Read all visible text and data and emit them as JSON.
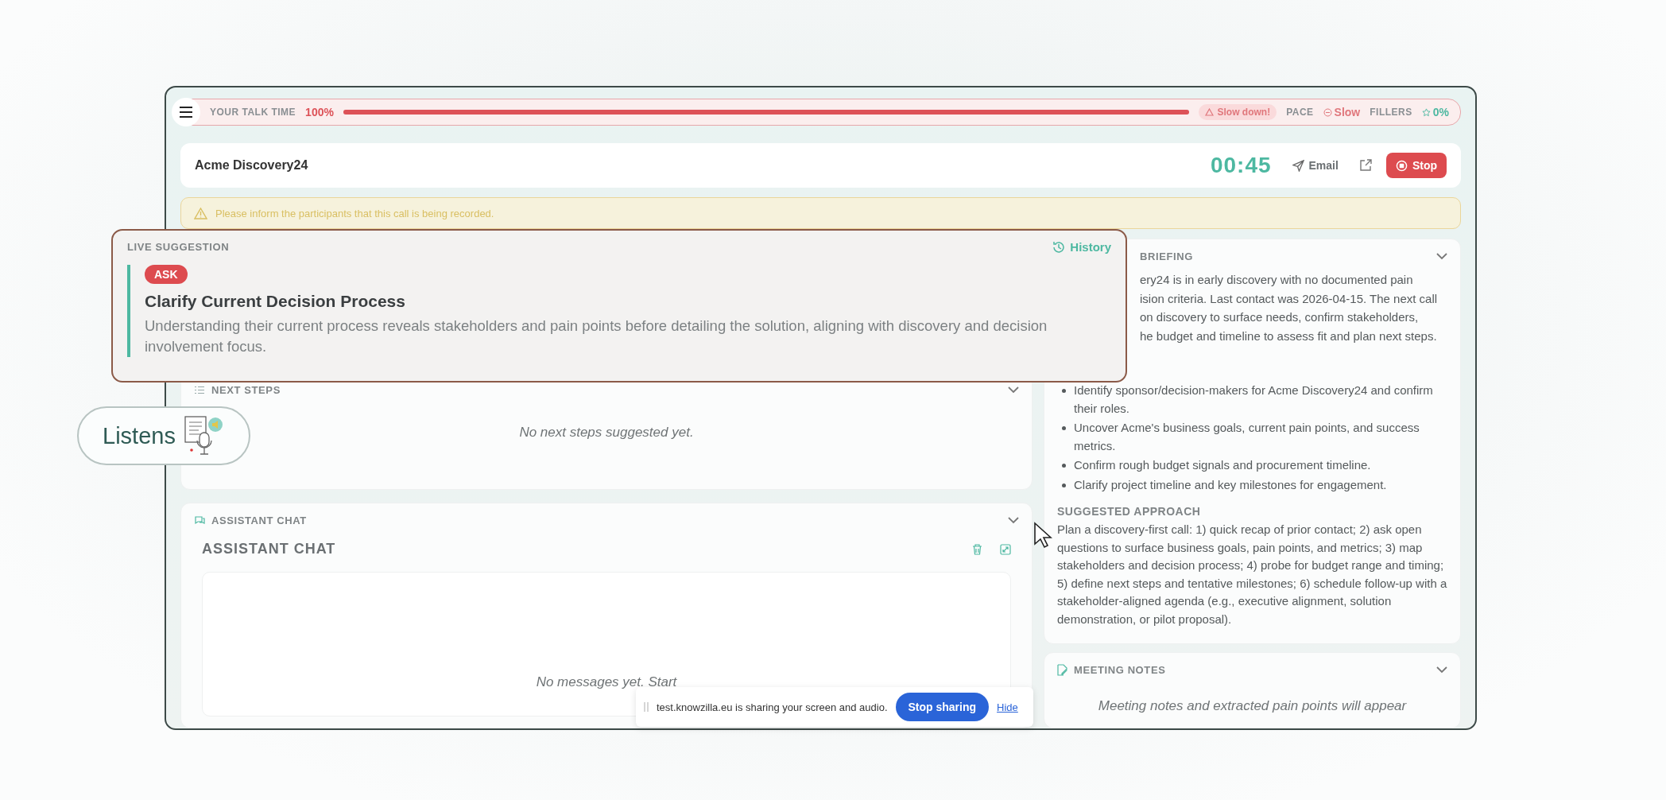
{
  "talk_bar": {
    "label": "YOUR TALK TIME",
    "value": "100%",
    "level": 1,
    "warning": "Slow down!",
    "pace_label": "PACE",
    "pace": "Slow",
    "fillers_label": "FILLERS",
    "fillers": "0%"
  },
  "header": {
    "title": "Acme Discovery24",
    "timer": "00:45",
    "email": "Email",
    "stop": "Stop"
  },
  "notice": "Please inform the participants that this call is being recorded.",
  "live_suggestion": {
    "label": "LIVE SUGGESTION",
    "history": "History",
    "tag": "ASK",
    "title": "Clarify Current Decision Process",
    "body": "Understanding their current process reveals stakeholders and pain points before detailing the solution, aligning with discovery and decision involvement focus."
  },
  "listens": "Listens",
  "next_steps": {
    "title": "NEXT STEPS",
    "empty": "No next steps suggested yet."
  },
  "assistant_chat": {
    "title": "ASSISTANT CHAT",
    "heading": "ASSISTANT CHAT",
    "empty": "No messages yet. Start"
  },
  "briefing": {
    "title": "BRIEFING",
    "summary_lines": [
      "ery24 is in early discovery with no documented pain",
      "ision criteria. Last contact was 2026-04-15. The next call",
      "on discovery to surface needs, confirm stakeholders,",
      "he budget and timeline to assess fit and plan next steps."
    ],
    "bullets": [
      "Identify sponsor/decision-makers for Acme Discovery24 and confirm their roles.",
      "Uncover Acme's business goals, current pain points, and success metrics.",
      "Confirm rough budget signals and procurement timeline.",
      "Clarify project timeline and key milestones for engagement."
    ],
    "approach_title": "SUGGESTED APPROACH",
    "approach": "Plan a discovery-first call: 1) quick recap of prior contact; 2) ask open questions to surface business goals, pain points, and metrics; 3) map stakeholders and decision process; 4) probe for budget range and timing; 5) define next steps and tentative milestones; 6) schedule follow-up with a stakeholder-aligned agenda (e.g., executive alignment, solution demonstration, or pilot proposal)."
  },
  "meeting_notes": {
    "title": "MEETING NOTES",
    "empty": "Meeting notes and extracted pain points will appear"
  },
  "share_bar": {
    "message": "test.knowzilla.eu is sharing your screen and audio.",
    "stop": "Stop sharing",
    "hide": "Hide"
  }
}
